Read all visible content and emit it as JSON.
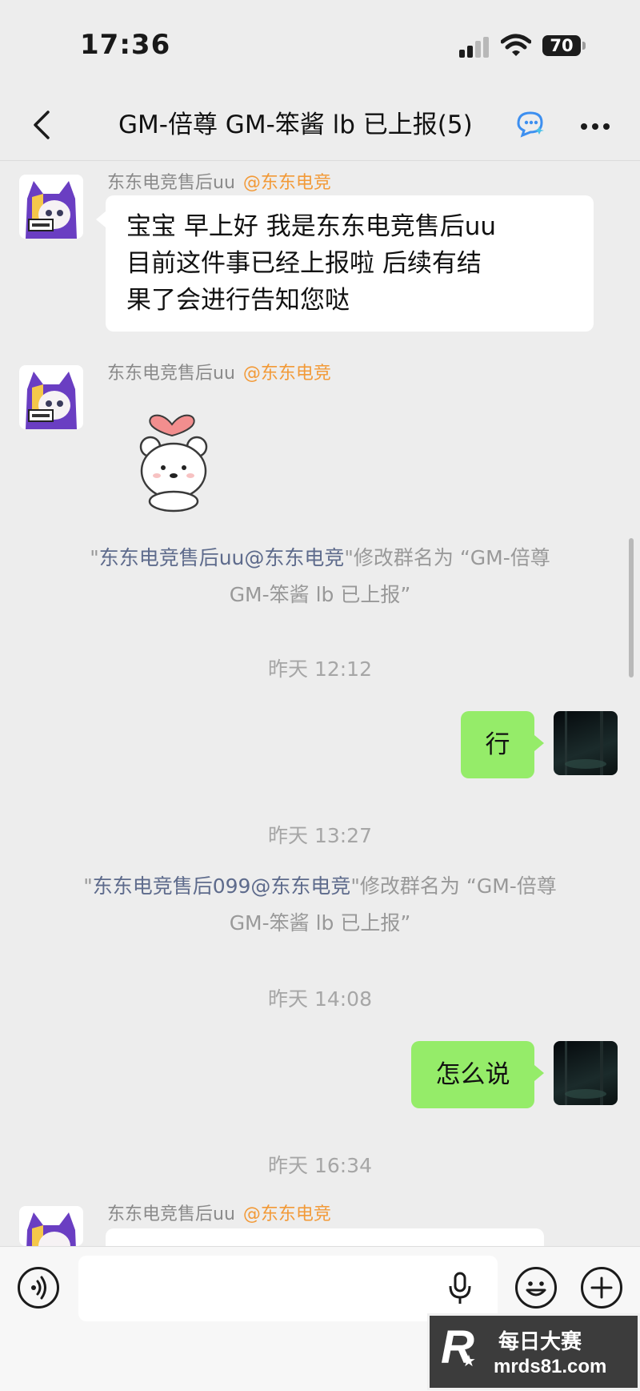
{
  "status_bar": {
    "time": "17:36",
    "battery": "70"
  },
  "nav": {
    "title": "GM-倍尊 GM-笨酱 lb 已上报(5)"
  },
  "messages": {
    "m1": {
      "sender": "东东电竞售后uu",
      "sender_tag": "@东东电竞",
      "lines": [
        "宝宝 早上好 我是东东电竞售后uu",
        "目前这件事已经上报啦 后续有结",
        "果了会进行告知您哒"
      ]
    },
    "m2": {
      "sender": "东东电竞售后uu",
      "sender_tag": "@东东电竞"
    },
    "sys1": {
      "quote_open": "\"",
      "name": "东东电竞售后uu@东东电竞",
      "rest": "\"修改群名为 “GM-倍尊",
      "line2": "GM-笨酱 lb 已上报”"
    },
    "ts1": "昨天 12:12",
    "m3": {
      "text": "行"
    },
    "ts2": "昨天 13:27",
    "sys2": {
      "quote_open": "\"",
      "name": "东东电竞售后099@东东电竞",
      "rest": "\"修改群名为 “GM-倍尊",
      "line2": "GM-笨酱 lb 已上报”"
    },
    "ts3": "昨天 14:08",
    "m4": {
      "text": "怎么说"
    },
    "ts4": "昨天 16:34",
    "m5": {
      "sender": "东东电竞售后uu",
      "sender_tag": "@东东电竞"
    }
  },
  "input": {
    "placeholder": ""
  },
  "watermark": {
    "line1": "每日大赛",
    "line2": "mrds81.com",
    "logo": "R"
  },
  "colors": {
    "bubble_out": "#95ec69",
    "bubble_in": "#ffffff",
    "background": "#ededed",
    "at_tag": "#f29a38",
    "sys_name": "#5e6b8c"
  },
  "icons": [
    "back-chevron-icon",
    "ai-assistant-icon",
    "more-icon",
    "voice-icon",
    "microphone-icon",
    "emoji-icon",
    "add-icon",
    "signal-icon",
    "wifi-icon",
    "battery-icon"
  ]
}
